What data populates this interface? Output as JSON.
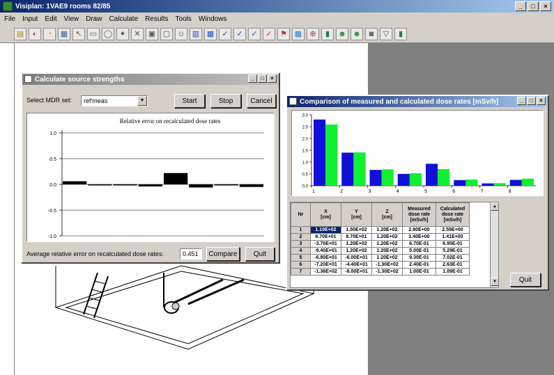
{
  "app": {
    "title": "Visiplan: 1VAE9 rooms 82/85",
    "menu": [
      "File",
      "Input",
      "Edit",
      "View",
      "Draw",
      "Calculate",
      "Results",
      "Tools",
      "Windows"
    ],
    "toolbar_icons": [
      "open-icon",
      "wizard-icon",
      "pie-icon",
      "grid-icon",
      "cursor-icon",
      "frame-icon",
      "ellipse-icon",
      "source-icon",
      "cross-icon",
      "solid-icon",
      "wire-icon",
      "person-icon",
      "chart-icon",
      "matrix-icon",
      "check-icon",
      "check2-icon",
      "check3-icon",
      "check4-icon",
      "flag-icon",
      "table-icon",
      "dose-icon",
      "bar-icon",
      "person2-icon",
      "person3-icon",
      "camera-icon",
      "filter-icon",
      "bar2-icon"
    ],
    "colors": {
      "measured": "#1010d8",
      "calculated": "#10f030",
      "active_title": "#0a246a"
    }
  },
  "strengths_dialog": {
    "title": "Calculate source strengths",
    "select_label": "Select MDR set:",
    "select_value": "ref'meas",
    "start_label": "Start",
    "stop_label": "Stop",
    "cancel_label": "Cancel",
    "plot_title": "Relative error on recalculated dose rates",
    "y_ticks": [
      "1.0",
      "0.5",
      "0.0",
      "-0.5",
      "-1.0"
    ],
    "avg_label": "Average relative error on recalculated dose rates:",
    "avg_value": "0.451",
    "compare_label": "Compare",
    "quit_label": "Quit"
  },
  "comparison_dialog": {
    "title": "Comparison of measured and calculated dose rates [mSv/h]",
    "y_ticks": [
      "3.0",
      "2.5",
      "2.0",
      "1.5",
      "1.0",
      "0.5",
      "0.0"
    ],
    "x_ticks": [
      "1",
      "2",
      "3",
      "4",
      "5",
      "6",
      "7",
      "8"
    ],
    "table": {
      "headers": [
        "Nr",
        "X\n[cm]",
        "Y\n[cm]",
        "Z\n[cm]",
        "Measured\ndose rate\n[mSv/h]",
        "Calculated\ndose rate\n[mSv/h]"
      ],
      "rows": [
        [
          "1",
          "1.10E+02",
          "1.50E+02",
          "1.20E+02",
          "2.80E+00",
          "2.59E+00"
        ],
        [
          "2",
          "8.70E+01",
          "8.70E+01",
          "1.20E+02",
          "1.40E+00",
          "1.41E+00"
        ],
        [
          "3",
          "-3.70E+01",
          "1.20E+02",
          "1.20E+02",
          "6.70E-01",
          "6.95E-01"
        ],
        [
          "4",
          "-9.40E+01",
          "1.20E+02",
          "1.20E+02",
          "5.00E-01",
          "5.29E-01"
        ],
        [
          "5",
          "-6.80E+01",
          "-6.00E+01",
          "1.20E+02",
          "9.30E-01",
          "7.02E-01"
        ],
        [
          "6",
          "-7.20E+01",
          "-4.40E+01",
          "-1.30E+02",
          "2.40E-01",
          "2.63E-01"
        ],
        [
          "7",
          "-1.36E+02",
          "-8.00E+01",
          "-1.30E+02",
          "1.00E-01",
          "1.09E-01"
        ]
      ]
    },
    "quit_label": "Quit"
  },
  "chart_data": [
    {
      "type": "bar",
      "title": "Relative error on recalculated dose rates",
      "categories": [
        "1",
        "2",
        "3",
        "4",
        "5",
        "6",
        "7",
        "8"
      ],
      "values": [
        0.06,
        0.0,
        -0.02,
        -0.04,
        0.22,
        -0.06,
        -0.02,
        -0.05
      ],
      "ylim": [
        -1.0,
        1.0
      ]
    },
    {
      "type": "bar",
      "title": "Comparison of measured and calculated dose rates [mSv/h]",
      "categories": [
        "1",
        "2",
        "3",
        "4",
        "5",
        "6",
        "7",
        "8"
      ],
      "series": [
        {
          "values": [
            2.8,
            1.4,
            0.67,
            0.5,
            0.93,
            0.24,
            0.1,
            0.25
          ]
        },
        {
          "values": [
            2.59,
            1.41,
            0.695,
            0.529,
            0.702,
            0.263,
            0.109,
            0.3
          ]
        }
      ],
      "ylim": [
        0,
        3.0
      ]
    }
  ]
}
